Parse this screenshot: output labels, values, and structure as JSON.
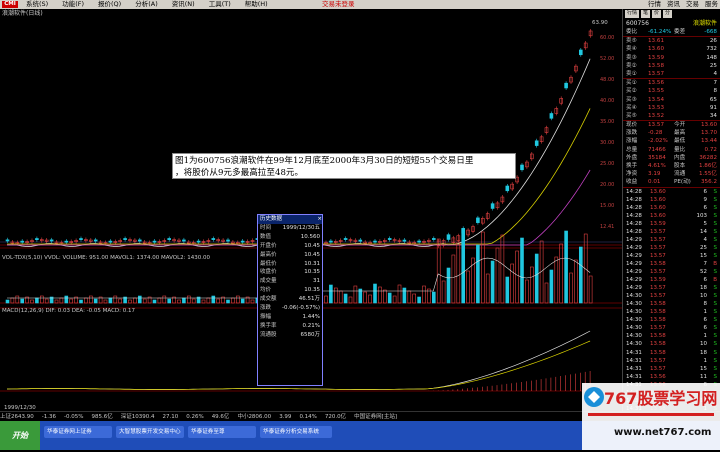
{
  "menubar": {
    "logo": "CMI",
    "items": [
      "系统(S)",
      "功能(F)",
      "报价(Q)",
      "分析(A)",
      "资讯(N)",
      "工具(T)",
      "帮助(H)"
    ],
    "center_text": "交易未登录",
    "right_items": [
      "行情",
      "资讯",
      "交易",
      "服务"
    ]
  },
  "chart_title": "浪潮软件(日线)",
  "chart_labels": {
    "high_marker": "63.90",
    "vol_line": "VOL-TDX(5,10) VVOL: VOLUME: 951.00 MAVOL1: 1374.00 MAVOL2: 1430.00",
    "macd_line": "MACD(12,26,9) DIF: 0.03 DEA: -0.05 MACD: 0.17",
    "date_label": "1999/12/30",
    "y_axis_price": [
      "60.00",
      "52.00",
      "48.00",
      "40.00",
      "35.00",
      "30.00",
      "25.00",
      "20.00",
      "15.00",
      "12.41"
    ],
    "y_axis_vol": [
      "1000",
      "500"
    ],
    "y_axis_macd": [
      "5.00",
      "0.00"
    ]
  },
  "infobox": {
    "line1": "图1为600756浪潮软件在99年12月底至2000年3月30日的短短55个交易日里",
    "line2": "，将股价从9元多最高拉至48元。"
  },
  "popup": {
    "title": "历史数据",
    "rows": [
      {
        "k": "时间",
        "v": "1999/12/30五"
      },
      {
        "k": "数值",
        "v": "10.560"
      },
      {
        "k": "开盘价",
        "v": "10.45"
      },
      {
        "k": "最高价",
        "v": "10.45"
      },
      {
        "k": "最低价",
        "v": "10.31"
      },
      {
        "k": "收盘价",
        "v": "10.35"
      },
      {
        "k": "成交量",
        "v": "31"
      },
      {
        "k": "均价",
        "v": "10.35"
      },
      {
        "k": "成交额",
        "v": "46.51万"
      },
      {
        "k": "涨跌",
        "v": "-0.06(-0.57%)"
      },
      {
        "k": "振幅",
        "v": "1.44%"
      },
      {
        "k": "换手率",
        "v": "0.21%"
      },
      {
        "k": "流通股",
        "v": "6580万"
      }
    ]
  },
  "panel": {
    "tools": [
      "行情",
      "笔",
      "价",
      "分"
    ],
    "stock_code": "600756",
    "stock_name": "浪潮软件",
    "ratio_label": "委比",
    "ratio_value": "-61.24%",
    "diff_label": "委差",
    "diff_value": "-668",
    "sells": [
      {
        "l": "卖⑤",
        "p": "13.61",
        "n": "26"
      },
      {
        "l": "卖④",
        "p": "13.60",
        "n": "732"
      },
      {
        "l": "卖③",
        "p": "13.59",
        "n": "148"
      },
      {
        "l": "卖②",
        "p": "13.58",
        "n": "25"
      },
      {
        "l": "卖①",
        "p": "13.57",
        "n": "4"
      }
    ],
    "buys": [
      {
        "l": "买①",
        "p": "13.56",
        "n": "7"
      },
      {
        "l": "买②",
        "p": "13.55",
        "n": "8"
      },
      {
        "l": "买③",
        "p": "13.54",
        "n": "65"
      },
      {
        "l": "买④",
        "p": "13.53",
        "n": "91"
      },
      {
        "l": "买⑤",
        "p": "13.52",
        "n": "34"
      }
    ],
    "stats": [
      {
        "a": "现价",
        "b": "13.57",
        "c": "今开",
        "d": "13.60"
      },
      {
        "a": "涨跌",
        "b": "-0.28",
        "c": "最高",
        "d": "13.70"
      },
      {
        "a": "涨幅",
        "b": "-2.02%",
        "c": "最低",
        "d": "13.44"
      },
      {
        "a": "总量",
        "b": "71466",
        "c": "量比",
        "d": "0.72"
      },
      {
        "a": "外盘",
        "b": "35184",
        "c": "内盘",
        "d": "36282"
      },
      {
        "a": "换手",
        "b": "4.61%",
        "c": "股本",
        "d": "1.86亿"
      },
      {
        "a": "净资",
        "b": "3.19",
        "c": "流通",
        "d": "1.55亿"
      },
      {
        "a": "收益",
        "b": "0.01",
        "c": "PE(动)",
        "d": "356.2"
      }
    ],
    "ticks": [
      {
        "t": "14:28",
        "p": "13.60",
        "v": "6",
        "s": "S"
      },
      {
        "t": "14:28",
        "p": "13.60",
        "v": "9",
        "s": "S"
      },
      {
        "t": "14:28",
        "p": "13.60",
        "v": "6",
        "s": "S"
      },
      {
        "t": "14:28",
        "p": "13.60",
        "v": "103",
        "s": "S"
      },
      {
        "t": "14:28",
        "p": "13.59",
        "v": "5",
        "s": "S"
      },
      {
        "t": "14:28",
        "p": "13.57",
        "v": "14",
        "s": "S"
      },
      {
        "t": "14:29",
        "p": "13.57",
        "v": "4",
        "s": "S"
      },
      {
        "t": "14:29",
        "p": "13.57",
        "v": "25",
        "s": "S"
      },
      {
        "t": "14:29",
        "p": "13.57",
        "v": "15",
        "s": "S"
      },
      {
        "t": "14:29",
        "p": "13.58",
        "v": "7",
        "s": "B"
      },
      {
        "t": "14:29",
        "p": "13.57",
        "v": "52",
        "s": "S"
      },
      {
        "t": "14:29",
        "p": "13.59",
        "v": "6",
        "s": "B"
      },
      {
        "t": "14:29",
        "p": "13.57",
        "v": "18",
        "s": "S"
      },
      {
        "t": "14:30",
        "p": "13.57",
        "v": "10",
        "s": "S"
      },
      {
        "t": "14:30",
        "p": "13.58",
        "v": "8",
        "s": "S"
      },
      {
        "t": "14:30",
        "p": "13.58",
        "v": "1",
        "s": "S"
      },
      {
        "t": "14:30",
        "p": "13.58",
        "v": "6",
        "s": "S"
      },
      {
        "t": "14:30",
        "p": "13.57",
        "v": "6",
        "s": "S"
      },
      {
        "t": "14:30",
        "p": "13.58",
        "v": "1",
        "s": "S"
      },
      {
        "t": "14:30",
        "p": "13.58",
        "v": "10",
        "s": "S"
      },
      {
        "t": "14:31",
        "p": "13.58",
        "v": "18",
        "s": "S"
      },
      {
        "t": "14:31",
        "p": "13.57",
        "v": "1",
        "s": "S"
      },
      {
        "t": "14:31",
        "p": "13.57",
        "v": "15",
        "s": "S"
      },
      {
        "t": "14:31",
        "p": "13.56",
        "v": "11",
        "s": "S"
      },
      {
        "t": "14:31",
        "p": "13.56",
        "v": "6",
        "s": "S"
      },
      {
        "t": "14:31",
        "p": "13.57",
        "v": "1",
        "s": "S"
      },
      {
        "t": "14:31",
        "p": "13.58",
        "v": "14",
        "s": "S"
      },
      {
        "t": "14:31",
        "p": "13.58",
        "v": "1",
        "s": "S"
      }
    ]
  },
  "status": {
    "items": [
      "上证2643.90",
      "-1.36",
      "-0.05%",
      "985.6亿",
      "深证10390.4",
      "27.10",
      "0.26%",
      "49.6亿",
      "中小2806.00",
      "3.99",
      "0.14%",
      "720.0亿",
      "中国证券网[主站]"
    ]
  },
  "taskbar": {
    "start": "开始",
    "buttons": [
      "华泰证券网上证券",
      "大智慧股票开发交易中心",
      "华泰证券至尊",
      "华泰证券分析交易系统"
    ]
  },
  "watermark": {
    "title": "767股票学习网",
    "url": "www.net767.com"
  },
  "colors": {
    "up": "#e04040",
    "down": "#20c8e0",
    "ma5": "#e0e0e0",
    "ma10": "#d8d000",
    "ma20": "#c040c0"
  }
}
